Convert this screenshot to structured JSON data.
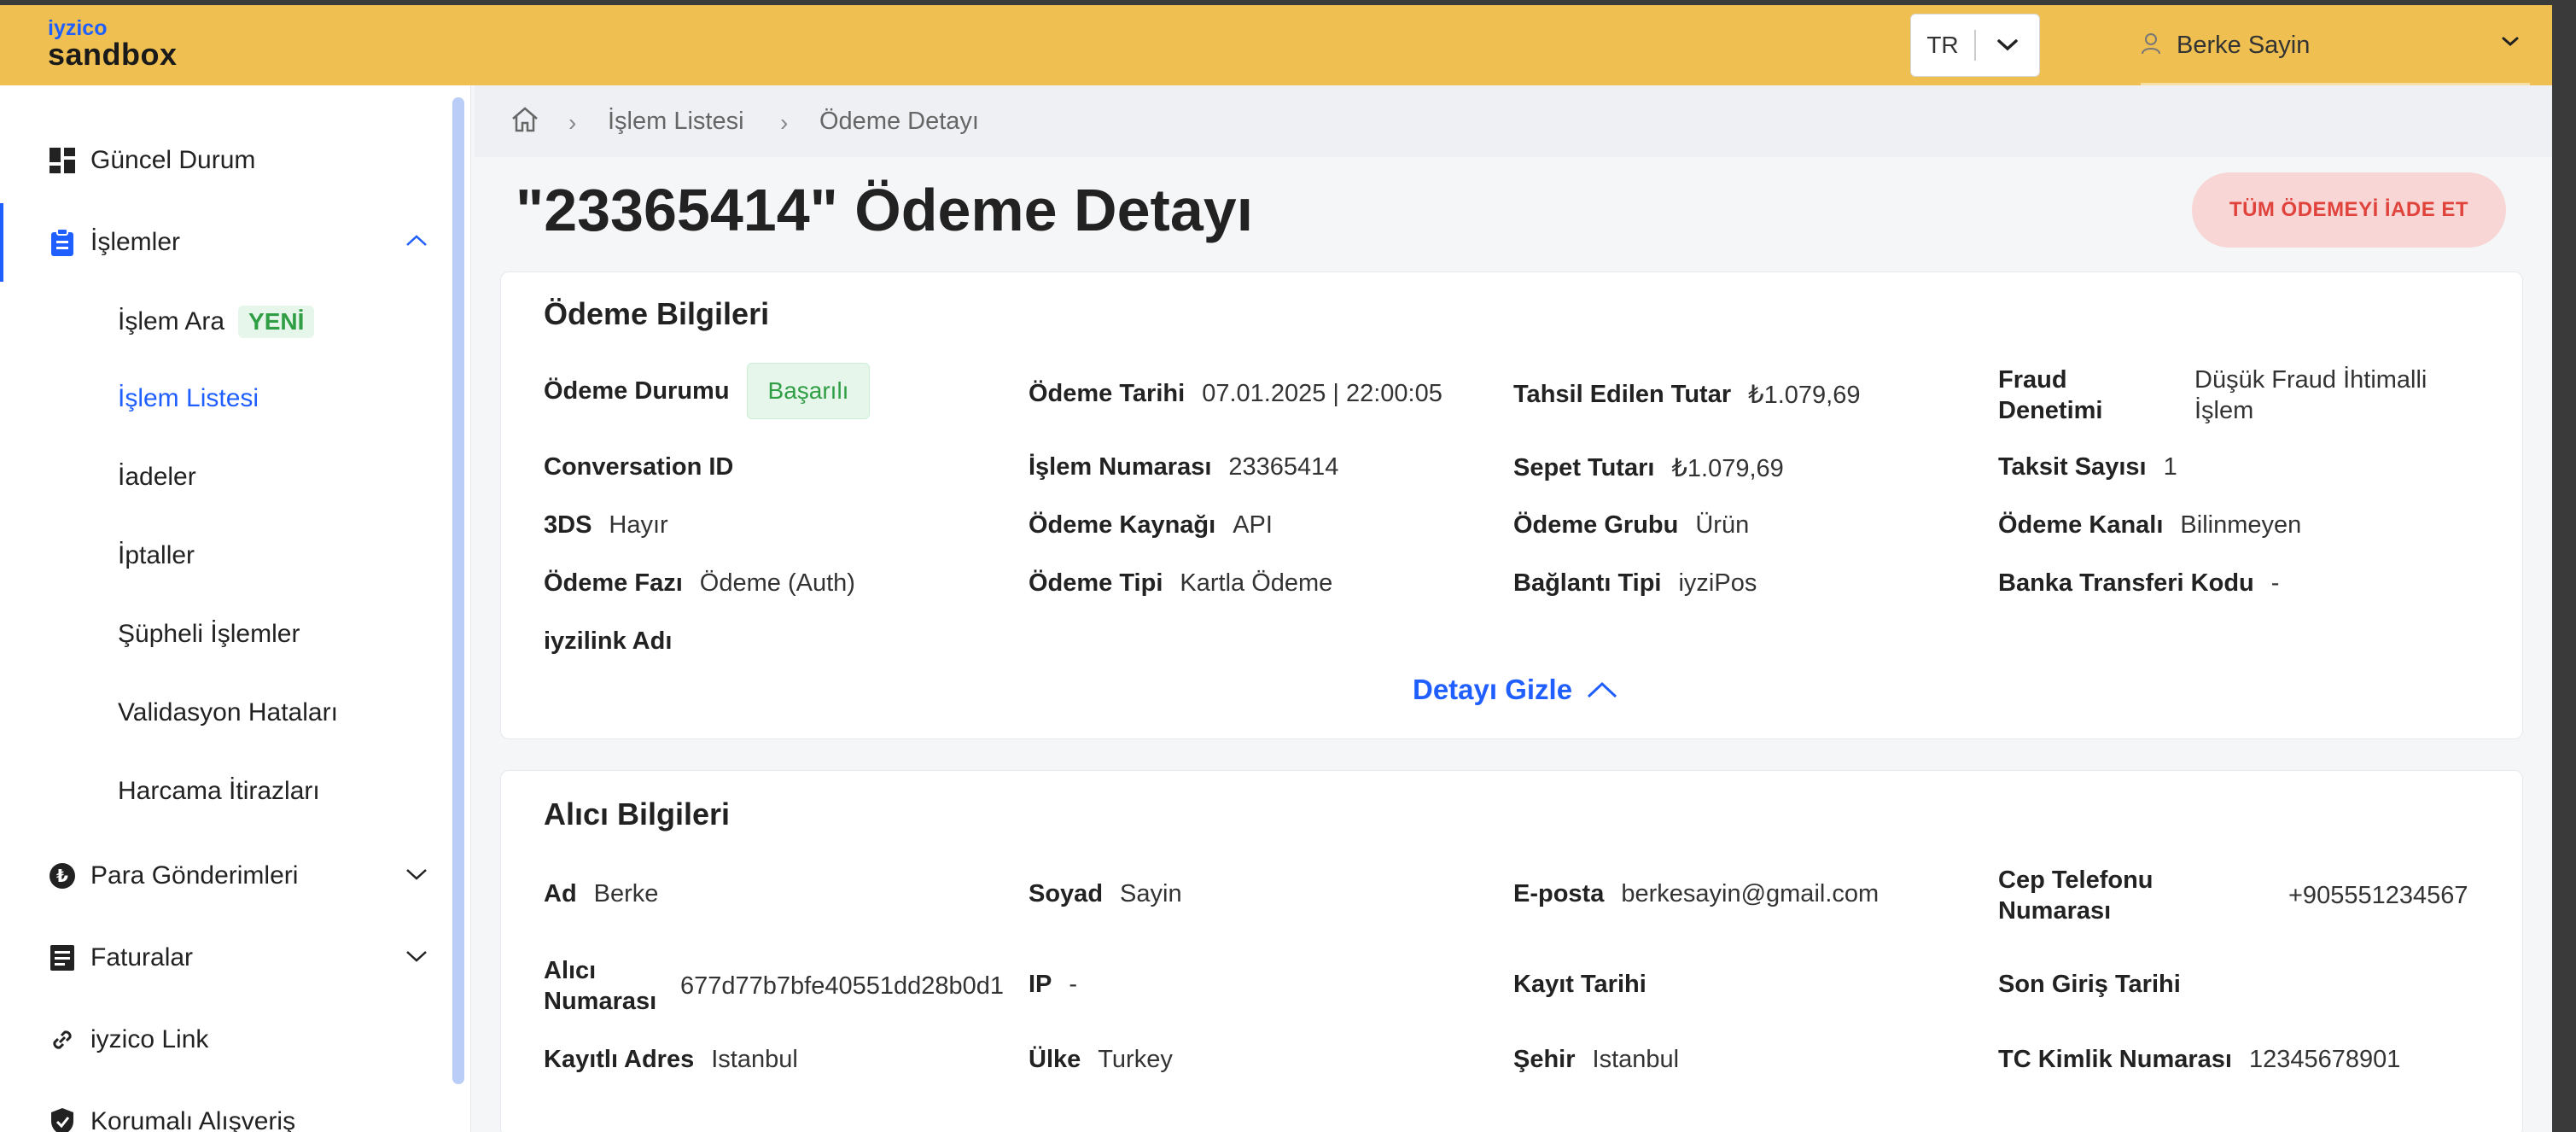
{
  "header": {
    "logo_small": "iyzico",
    "logo_big": "sandbox",
    "language": "TR",
    "user_name": "Berke Sayin"
  },
  "sidebar": {
    "items": [
      {
        "label": "Güncel Durum",
        "icon": "dashboard-icon"
      },
      {
        "label": "İşlemler",
        "icon": "clipboard-icon"
      },
      {
        "label": "Para Gönderimleri",
        "icon": "currency-icon"
      },
      {
        "label": "Faturalar",
        "icon": "invoice-icon"
      },
      {
        "label": "iyzico Link",
        "icon": "link-icon"
      },
      {
        "label": "Korumalı Alışveriş",
        "icon": "shield-icon"
      }
    ],
    "sub_items": [
      {
        "label": "İşlem Ara",
        "badge": "YENİ"
      },
      {
        "label": "İşlem Listesi"
      },
      {
        "label": "İadeler"
      },
      {
        "label": "İptaller"
      },
      {
        "label": "Şüpheli İşlemler"
      },
      {
        "label": "Validasyon Hataları"
      },
      {
        "label": "Harcama İtirazları"
      }
    ]
  },
  "breadcrumb": {
    "items": [
      "İşlem Listesi",
      "Ödeme Detayı"
    ]
  },
  "page": {
    "title": "\"23365414\" Ödeme Detayı",
    "refund_button": "TÜM ÖDEMEYİ İADE ET"
  },
  "payment": {
    "title": "Ödeme Bilgileri",
    "toggle_label": "Detayı Gizle",
    "fields": {
      "status": {
        "k": "Ödeme Durumu",
        "v": "Başarılı"
      },
      "date": {
        "k": "Ödeme Tarihi",
        "v": "07.01.2025 | 22:00:05"
      },
      "collected": {
        "k": "Tahsil Edilen Tutar",
        "v": "₺1.079,69"
      },
      "fraud": {
        "k": "Fraud Denetimi",
        "v": "Düşük Fraud İhtimalli İşlem"
      },
      "conversation": {
        "k": "Conversation ID",
        "v": ""
      },
      "txn_no": {
        "k": "İşlem Numarası",
        "v": "23365414"
      },
      "basket": {
        "k": "Sepet Tutarı",
        "v": "₺1.079,69"
      },
      "installment": {
        "k": "Taksit Sayısı",
        "v": "1"
      },
      "threeds": {
        "k": "3DS",
        "v": "Hayır"
      },
      "source": {
        "k": "Ödeme Kaynağı",
        "v": "API"
      },
      "group": {
        "k": "Ödeme Grubu",
        "v": "Ürün"
      },
      "channel": {
        "k": "Ödeme Kanalı",
        "v": "Bilinmeyen"
      },
      "phase": {
        "k": "Ödeme Fazı",
        "v": "Ödeme (Auth)"
      },
      "type": {
        "k": "Ödeme Tipi",
        "v": "Kartla Ödeme"
      },
      "connection": {
        "k": "Bağlantı Tipi",
        "v": "iyziPos"
      },
      "bank_code": {
        "k": "Banka Transferi Kodu",
        "v": "-"
      },
      "iyzilink": {
        "k": "iyzilink Adı",
        "v": ""
      }
    }
  },
  "buyer": {
    "title": "Alıcı Bilgileri",
    "fields": {
      "name": {
        "k": "Ad",
        "v": "Berke"
      },
      "surname": {
        "k": "Soyad",
        "v": "Sayin"
      },
      "email": {
        "k": "E-posta",
        "v": "berkesayin@gmail.com"
      },
      "phone": {
        "k": "Cep Telefonu Numarası",
        "v": "+905551234567"
      },
      "buyer_no": {
        "k": "Alıcı Numarası",
        "v": "677d77b7bfe40551dd28b0d1"
      },
      "ip": {
        "k": "IP",
        "v": "-"
      },
      "reg_date": {
        "k": "Kayıt Tarihi",
        "v": ""
      },
      "last_login": {
        "k": "Son Giriş Tarihi",
        "v": ""
      },
      "address": {
        "k": "Kayıtlı Adres",
        "v": "Istanbul"
      },
      "country": {
        "k": "Ülke",
        "v": "Turkey"
      },
      "city": {
        "k": "Şehir",
        "v": "Istanbul"
      },
      "tckn": {
        "k": "TC Kimlik Numarası",
        "v": "12345678901"
      }
    }
  },
  "colors": {
    "header_bg": "#efc051",
    "accent": "#1f5eff",
    "success": "#2f9e44",
    "danger": "#e0433b"
  }
}
